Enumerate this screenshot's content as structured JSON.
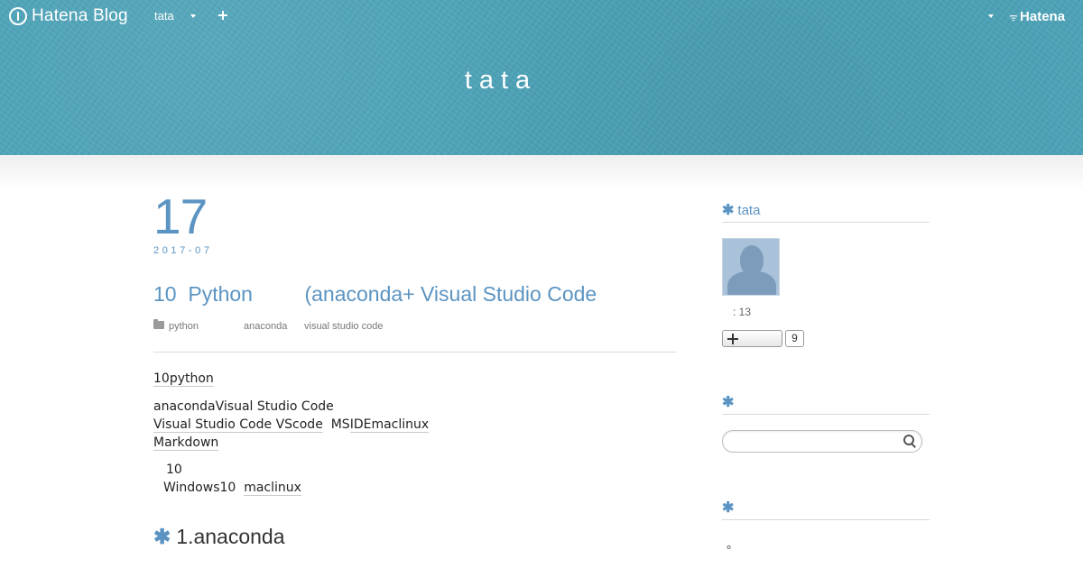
{
  "global_bar": {
    "brand": "Hatena Blog",
    "blog_menu_label": "tata",
    "hatena_label": "Hatena",
    "hatena_sig": "ᯤ"
  },
  "blog": {
    "title": "tata"
  },
  "entry": {
    "day": "17",
    "year_month": "2017-07",
    "title": "10  Python         (anaconda+ Visual Studio Code",
    "categories": [
      "python",
      "anaconda",
      "visual studio code"
    ],
    "body": {
      "p1": "10python",
      "p2_line1": "anacondaVisual Studio Code",
      "p2_line2_a": "Visual Studio Code ",
      "p2_line2_b": "VScode",
      "p2_line2_c": "  MS",
      "p2_line2_d": "IDEmaclinux",
      "p2_line3": "Markdown",
      "p3_line1": "10",
      "p3_line2_a": "Windows10  ",
      "p3_line2_b": "maclinux"
    },
    "section_heading": "1.anaconda",
    "section_asterisk": "✱"
  },
  "sidebar": {
    "profile_heading": "tata",
    "profile_asterisk": "✱",
    "reader_count": ": 13",
    "subscribe_count": "9",
    "search_heading": "",
    "search_asterisk": "✱",
    "search_placeholder": "",
    "links_heading": "",
    "links_asterisk": "✱",
    "links_text": "。"
  },
  "colors": {
    "header": "#4da3b9",
    "accent": "#5b94c2"
  }
}
